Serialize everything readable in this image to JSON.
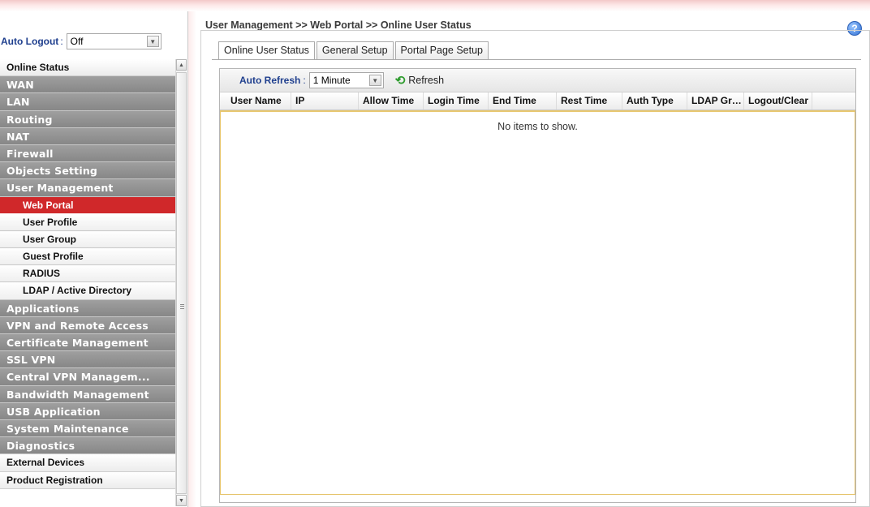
{
  "sidebar": {
    "auto_logout_label": "Auto Logout",
    "auto_logout_colon": ":",
    "auto_logout_value": "Off",
    "items": [
      {
        "label": "Online Status",
        "style": "white"
      },
      {
        "label": "WAN",
        "style": "gray"
      },
      {
        "label": "LAN",
        "style": "gray"
      },
      {
        "label": "Routing",
        "style": "gray"
      },
      {
        "label": "NAT",
        "style": "gray"
      },
      {
        "label": "Firewall",
        "style": "gray"
      },
      {
        "label": "Objects Setting",
        "style": "gray"
      },
      {
        "label": "User Management",
        "style": "gray"
      },
      {
        "label": "Web Portal",
        "style": "active"
      },
      {
        "label": "User Profile",
        "style": "sub"
      },
      {
        "label": "User Group",
        "style": "sub"
      },
      {
        "label": "Guest Profile",
        "style": "sub"
      },
      {
        "label": "RADIUS",
        "style": "sub"
      },
      {
        "label": "LDAP / Active Directory",
        "style": "sub"
      },
      {
        "label": "Applications",
        "style": "gray"
      },
      {
        "label": "VPN and Remote Access",
        "style": "gray"
      },
      {
        "label": "Certificate Management",
        "style": "gray"
      },
      {
        "label": "SSL VPN",
        "style": "gray"
      },
      {
        "label": "Central VPN Managem...",
        "style": "gray"
      },
      {
        "label": "Bandwidth Management",
        "style": "gray"
      },
      {
        "label": "USB Application",
        "style": "gray"
      },
      {
        "label": "System Maintenance",
        "style": "gray"
      },
      {
        "label": "Diagnostics",
        "style": "gray"
      },
      {
        "label": "External Devices",
        "style": "white"
      },
      {
        "label": "Product Registration",
        "style": "white"
      }
    ]
  },
  "main": {
    "breadcrumb": "User Management >> Web Portal >> Online User Status",
    "help_glyph": "?",
    "tabs": [
      {
        "label": "Online User Status",
        "active": true
      },
      {
        "label": "General Setup",
        "active": false
      },
      {
        "label": "Portal Page Setup",
        "active": false
      }
    ],
    "toolbar": {
      "auto_refresh_label": "Auto Refresh",
      "auto_refresh_colon": ":",
      "auto_refresh_value": "1 Minute",
      "refresh_label": "Refresh"
    },
    "columns": [
      "User Name",
      "IP",
      "Allow Time",
      "Login Time",
      "End Time",
      "Rest Time",
      "Auth Type",
      "LDAP Gro...",
      "Logout/Clear"
    ],
    "empty_text": "No items to show."
  },
  "icons": {
    "help": "help-icon",
    "refresh": "refresh-icon",
    "dropdown": "chevron-down-icon"
  },
  "colors": {
    "active_menu": "#d0282a",
    "menu_gray": "#939393",
    "label_blue": "#1f3f8e",
    "grid_border": "#e6c46b"
  }
}
